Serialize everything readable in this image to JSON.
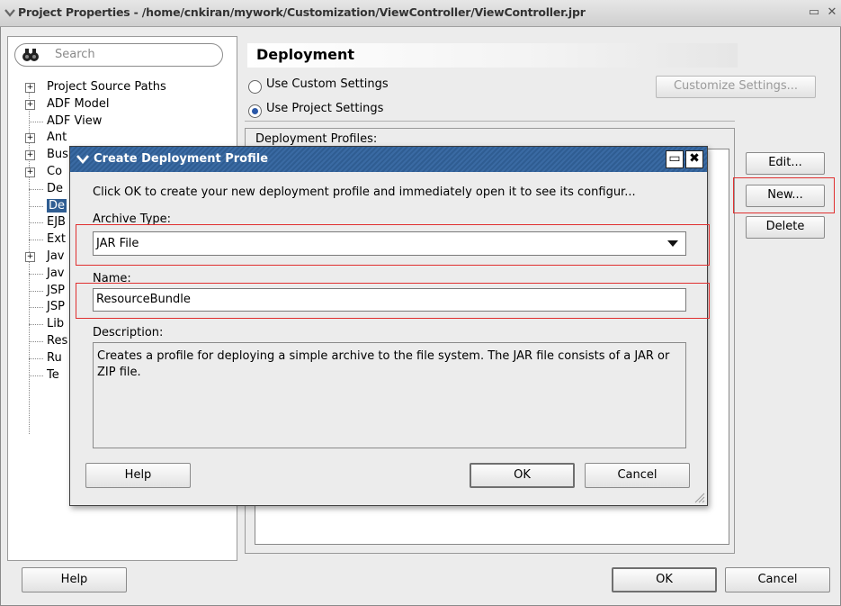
{
  "window": {
    "title": "Project Properties - /home/cnkiran/mywork/Customization/ViewController/ViewController.jpr"
  },
  "search": {
    "placeholder": "Search"
  },
  "tree": [
    {
      "label": "Project Source Paths",
      "expandable": true
    },
    {
      "label": "ADF Model",
      "expandable": true
    },
    {
      "label": "ADF View",
      "expandable": false
    },
    {
      "label": "Ant",
      "expandable": true
    },
    {
      "label": "Bus",
      "expandable": true
    },
    {
      "label": "Co",
      "expandable": true
    },
    {
      "label": "De",
      "expandable": false
    },
    {
      "label": "De",
      "expandable": false,
      "selected": true
    },
    {
      "label": "EJB",
      "expandable": false
    },
    {
      "label": "Ext",
      "expandable": false
    },
    {
      "label": "Jav",
      "expandable": true
    },
    {
      "label": "Jav",
      "expandable": false
    },
    {
      "label": "JSP",
      "expandable": false
    },
    {
      "label": "JSP",
      "expandable": false
    },
    {
      "label": "Lib",
      "expandable": false
    },
    {
      "label": "Res",
      "expandable": false
    },
    {
      "label": "Ru",
      "expandable": false
    },
    {
      "label": "Te",
      "expandable": false
    }
  ],
  "panel": {
    "title": "Deployment",
    "use_custom_settings": "Use Custom Settings",
    "use_project_settings": "Use Project Settings",
    "customize_settings": "Customize Settings...",
    "deployment_profiles_label": "Deployment Profiles:",
    "edit": "Edit...",
    "new": "New...",
    "delete": "Delete"
  },
  "dialog": {
    "title": "Create Deployment Profile",
    "intro": "Click OK to create your new deployment profile and immediately open it to see its configur...",
    "archive_type_label": "Archive Type:",
    "archive_type_value": "JAR File",
    "name_label": "Name:",
    "name_value": "ResourceBundle",
    "description_label": "Description:",
    "description_text": "Creates a profile for deploying a simple archive to the file system. The JAR file consists of a JAR or ZIP file.",
    "help": "Help",
    "ok": "OK",
    "cancel": "Cancel"
  },
  "footer": {
    "help": "Help",
    "ok": "OK",
    "cancel": "Cancel"
  },
  "colors": {
    "selection": "#2f5d92",
    "highlight": "#e03030"
  }
}
